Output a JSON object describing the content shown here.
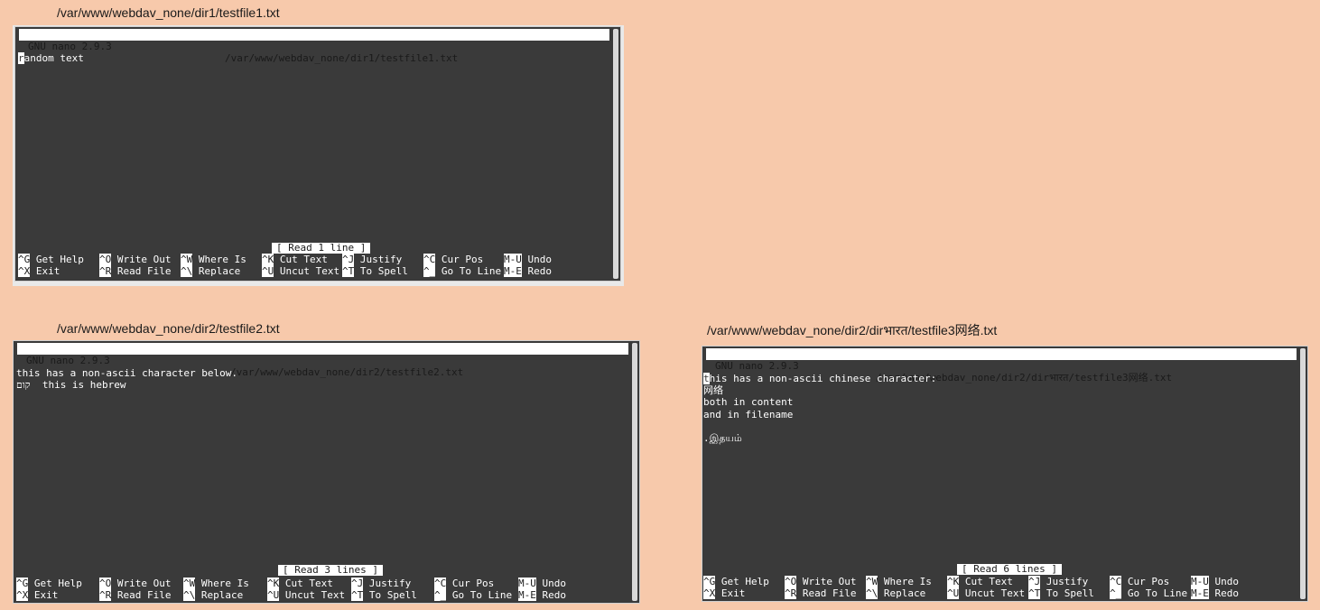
{
  "captions": {
    "top_left": "/var/www/webdav_none/dir1/testfile1.txt",
    "bottom_left": "/var/www/webdav_none/dir2/testfile2.txt",
    "bottom_right": "/var/www/webdav_none/dir2/dirभारत/testfile3网络.txt"
  },
  "editor1": {
    "app": "GNU nano 2.9.3",
    "path": "/var/www/webdav_none/dir1/testfile1.txt",
    "cursor_char": "r",
    "line1_rest": "andom text",
    "status": "[ Read 1 line ]"
  },
  "editor2": {
    "app": "GNU nano 2.9.3",
    "path": "/var/www/webdav_none/dir2/testfile2.txt",
    "lines": [
      "this has a non-ascii character below.",
      "קום  this is hebrew"
    ],
    "status": "[ Read 3 lines ]"
  },
  "editor3": {
    "app": "GNU nano 2.9.3",
    "path": "/var/www/webdav_none/dir2/dirभारत/testfile3网络.txt",
    "cursor_char": "t",
    "line1_rest": "his has a non-ascii chinese character:",
    "lines": [
      "网络",
      "both in content",
      "and in filename",
      "",
      ".இதயம்"
    ],
    "status": "[ Read 6 lines ]"
  },
  "shortcuts": {
    "get_help": {
      "key": "^G",
      "label": "Get Help"
    },
    "exit": {
      "key": "^X",
      "label": "Exit"
    },
    "write_out": {
      "key": "^O",
      "label": "Write Out"
    },
    "read_file": {
      "key": "^R",
      "label": "Read File"
    },
    "where_is": {
      "key": "^W",
      "label": "Where Is"
    },
    "replace": {
      "key": "^\\",
      "label": "Replace"
    },
    "cut_text": {
      "key": "^K",
      "label": "Cut Text"
    },
    "uncut_text": {
      "key": "^U",
      "label": "Uncut Text"
    },
    "justify": {
      "key": "^J",
      "label": "Justify"
    },
    "to_spell": {
      "key": "^T",
      "label": "To Spell"
    },
    "cur_pos": {
      "key": "^C",
      "label": "Cur Pos"
    },
    "go_to_line": {
      "key": "^_",
      "label": "Go To Line"
    },
    "undo": {
      "key": "M-U",
      "label": "Undo"
    },
    "redo": {
      "key": "M-E",
      "label": "Redo"
    }
  }
}
